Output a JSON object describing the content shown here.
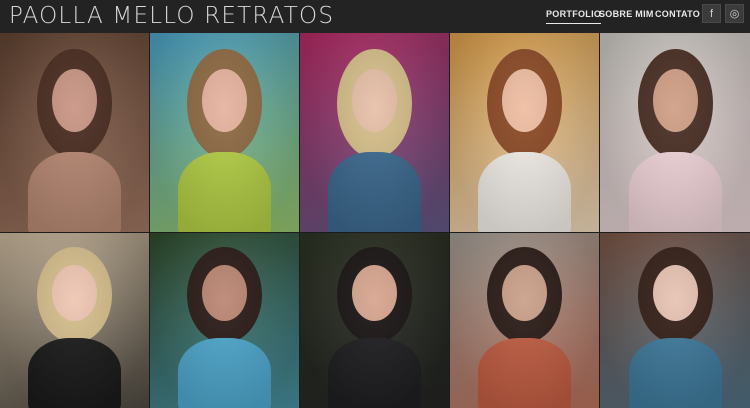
{
  "header": {
    "brand": "PAOLLA MELLO RETRATOS",
    "nav": [
      {
        "label": "PORTFOLIO",
        "active": true
      },
      {
        "label": "SOBRE MIM",
        "active": false
      },
      {
        "label": "CONTATO",
        "active": false
      }
    ],
    "social": [
      {
        "icon": "facebook-icon",
        "glyph": "f"
      },
      {
        "icon": "instagram-icon",
        "glyph": "◎"
      }
    ]
  },
  "gallery": {
    "photos": [
      {
        "name": "portrait-photo-1",
        "bg": "#5f4231",
        "accent": "#b98a74",
        "hair": "#4a2c20",
        "skin": "#c99483"
      },
      {
        "name": "portrait-photo-2",
        "bg": "#4aa0c5",
        "accent": "#b5d146",
        "hair": "#8f6b43",
        "skin": "#e6b39e"
      },
      {
        "name": "portrait-photo-3",
        "bg": "#b32a63",
        "accent": "#3d6a90",
        "hair": "#d8c08b",
        "skin": "#e7c0a8"
      },
      {
        "name": "portrait-photo-4",
        "bg": "#d89c47",
        "accent": "#f5f0ea",
        "hair": "#8d4b26",
        "skin": "#efbea2"
      },
      {
        "name": "portrait-photo-5",
        "bg": "#c9c6c0",
        "accent": "#f3d7dc",
        "hair": "#4a2f24",
        "skin": "#d09f86"
      },
      {
        "name": "portrait-photo-6",
        "bg": "#c9b79c",
        "accent": "#1b1b1b",
        "hair": "#d7c08d",
        "skin": "#efc6b2"
      },
      {
        "name": "portrait-photo-7",
        "bg": "#2f4a2a",
        "accent": "#4fa9cf",
        "hair": "#2b1b17",
        "skin": "#bb8672"
      },
      {
        "name": "portrait-photo-8",
        "bg": "#2d3324",
        "accent": "#1f1f22",
        "hair": "#1a1414",
        "skin": "#d7a58f"
      },
      {
        "name": "portrait-photo-9",
        "bg": "#9f9a92",
        "accent": "#c35e43",
        "hair": "#2b1c17",
        "skin": "#caa089"
      },
      {
        "name": "portrait-photo-10",
        "bg": "#7a5545",
        "accent": "#3f7b9d",
        "hair": "#352018",
        "skin": "#e7c3b3"
      }
    ]
  }
}
